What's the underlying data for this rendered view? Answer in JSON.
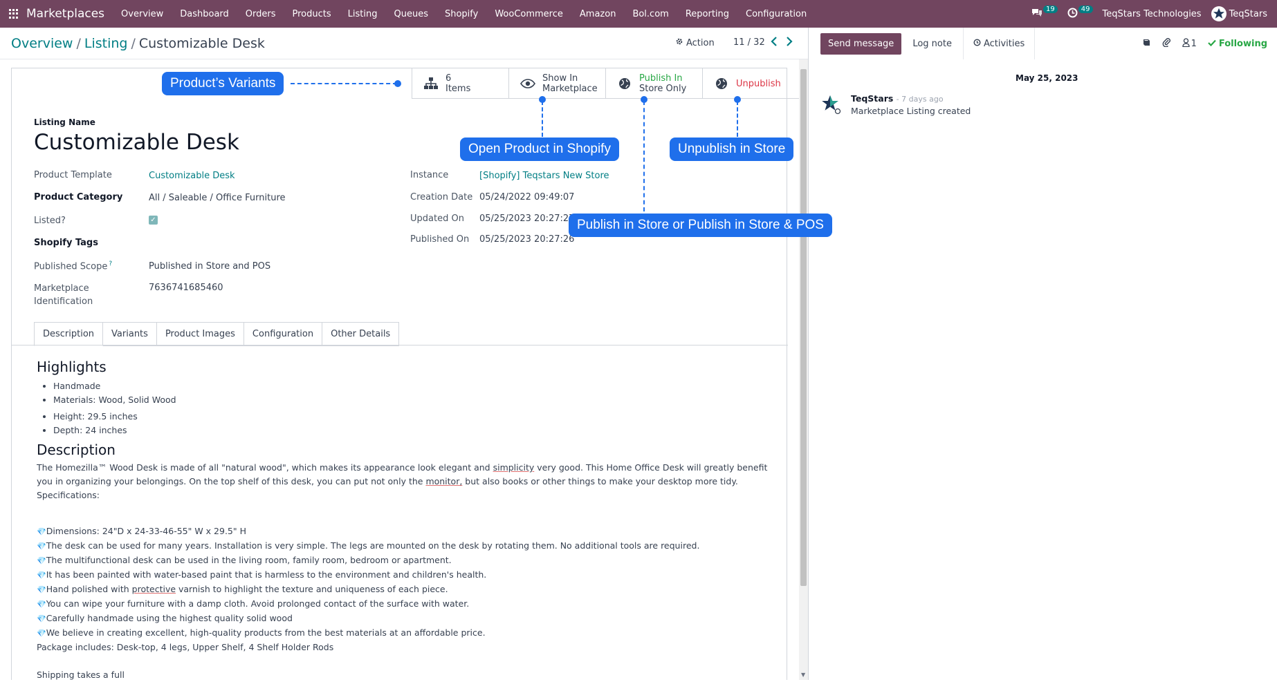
{
  "topbar": {
    "brand": "Marketplaces",
    "menu": [
      "Overview",
      "Dashboard",
      "Orders",
      "Products",
      "Listing",
      "Queues",
      "Shopify",
      "WooCommerce",
      "Amazon",
      "Bol.com",
      "Reporting",
      "Configuration"
    ],
    "messages_count": "19",
    "activities_count": "49",
    "company": "TeqStars Technologies",
    "user": "TeqStars",
    "bar_color": "#71455f"
  },
  "breadcrumb": {
    "items": [
      "Overview",
      "Listing"
    ],
    "current": "Customizable Desk"
  },
  "control": {
    "action_label": "Action",
    "pager": "11 / 32"
  },
  "chatter": {
    "send_message": "Send message",
    "log_note": "Log note",
    "activities": "Activities",
    "followers": "1",
    "following": "Following",
    "date": "May 25, 2023",
    "author": "TeqStars",
    "ago": "- 7 days ago",
    "message": "Marketplace Listing created"
  },
  "smart_buttons": {
    "items_count": "6",
    "items_label": "Items",
    "show_line1": "Show In",
    "show_line2": "Marketplace",
    "publish_line1": "Publish In",
    "publish_line2": "Store Only",
    "unpublish": "Unpublish"
  },
  "form": {
    "listing_name_label": "Listing Name",
    "title": "Customizable Desk",
    "product_template_label": "Product Template",
    "product_template": "Customizable Desk",
    "product_category_label": "Product Category",
    "product_category": "All / Saleable / Office Furniture",
    "listed_label": "Listed?",
    "listed": true,
    "shopify_tags_label": "Shopify Tags",
    "published_scope_label": "Published Scope",
    "published_scope": "Published in Store and POS",
    "marketplace_id_label1": "Marketplace",
    "marketplace_id_label2": "Identification",
    "marketplace_id": "7636741685460",
    "instance_label": "Instance",
    "instance": "[Shopify] Teqstars New Store",
    "creation_date_label": "Creation Date",
    "creation_date": "05/24/2022 09:49:07",
    "updated_on_label": "Updated On",
    "updated_on": "05/25/2023 20:27:27",
    "published_on_label": "Published On",
    "published_on": "05/25/2023 20:27:26"
  },
  "tabs": [
    "Description",
    "Variants",
    "Product Images",
    "Configuration",
    "Other Details"
  ],
  "description": {
    "highlights_title": "Highlights",
    "highlights": [
      "Handmade",
      "Materials: Wood, Solid Wood"
    ],
    "highlights2": [
      "Height: 29.5 inches",
      "Depth: 24 inches"
    ],
    "desc_title": "Description",
    "para_a": "The Homezilla™ Wood Desk is made of all \"natural wood\", which makes its appearance look elegant and ",
    "para_b": "simplicity",
    "para_c": " very good. This Home Office Desk will greatly benefit you in organizing your belongings. On the top shelf of this desk, you can put not only the ",
    "para_d": "monitor,",
    "para_e": " but also books or other things to make your desktop more tidy.",
    "specs": "Specifications:",
    "bullets": [
      "Dimensions: 24\"D x 24-33-46-55\" W x 29.5\" H",
      "The desk can be used for many years. Installation is very simple. The legs are mounted on the desk by rotating them. No additional tools are required.",
      "The multifunctional desk can be used in the living room, family room, bedroom or apartment.",
      "It has been painted with water-based paint that is harmless to the environment and children's health.",
      "Hand polished with ",
      "You can wipe your furniture with a damp cloth. Avoid prolonged contact of the surface with water.",
      "Carefully handmade using the highest quality solid wood",
      "We believe in creating excellent, high-quality products from the best materials at an affordable price."
    ],
    "bullet5_u": "protective",
    "bullet5_tail": " varnish to highlight the texture and uniqueness of each piece.",
    "package": "Package includes: Desk-top, 4 legs, Upper Shelf, 4 Shelf Holder Rods",
    "cut_off": "Shipping takes a full"
  },
  "callouts": {
    "variants": "Product’s Variants",
    "open_shopify": "Open Product in Shopify",
    "unpublish": "Unpublish in Store",
    "publish": "Publish in Store or Publish in Store & POS",
    "color": "#1f6feb"
  }
}
